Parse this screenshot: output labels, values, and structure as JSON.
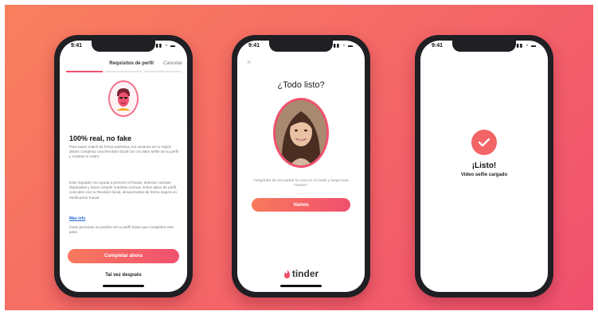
{
  "status_time": "9:41",
  "status_icons": "▮▮ ◔ ▬",
  "phone1": {
    "nav_title": "Requisitos de perfil",
    "nav_cancel": "Cancelar",
    "heading": "100% real, no fake",
    "para_a": "Para hacer match de forma auténtica, los usuarios de tu región deben completar una Revisión facial con un video selfie de su perfil y mostrar tu rostro.",
    "para_b": "Este requisito nos ayuda a prevenir el fraude, detectar cuentas duplicadas y hacer cumplir nuestras normas. Estos datos de perfil coinciden con tu Revisión facial, almacenados de forma segura en Verificación Facial.",
    "more_link": "Más info",
    "para_c": "Otras personas no podrán ver tu perfil hasta que completes este paso.",
    "cta": "Completar ahora",
    "later": "Tal vez después"
  },
  "phone2": {
    "close": "×",
    "title": "¿Todo listo?",
    "text": "Asegúrate de encuadrar tu cara en el óvalo y luego toca \"Vamos\".",
    "cta": "Vamos",
    "brand": "tinder"
  },
  "phone3": {
    "title": "¡Listo!",
    "subtitle": "Video selfie cargado"
  }
}
